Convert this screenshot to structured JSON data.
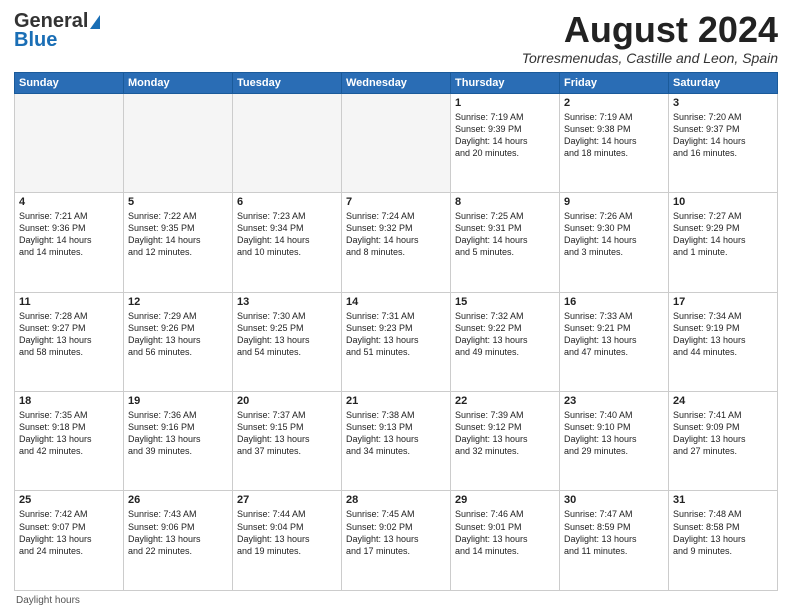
{
  "header": {
    "logo_general": "General",
    "logo_blue": "Blue",
    "title": "August 2024",
    "location": "Torresmenudas, Castille and Leon, Spain"
  },
  "footer": {
    "daylight_label": "Daylight hours"
  },
  "days_of_week": [
    "Sunday",
    "Monday",
    "Tuesday",
    "Wednesday",
    "Thursday",
    "Friday",
    "Saturday"
  ],
  "weeks": [
    [
      {
        "day": "",
        "info": ""
      },
      {
        "day": "",
        "info": ""
      },
      {
        "day": "",
        "info": ""
      },
      {
        "day": "",
        "info": ""
      },
      {
        "day": "1",
        "info": "Sunrise: 7:19 AM\nSunset: 9:39 PM\nDaylight: 14 hours\nand 20 minutes."
      },
      {
        "day": "2",
        "info": "Sunrise: 7:19 AM\nSunset: 9:38 PM\nDaylight: 14 hours\nand 18 minutes."
      },
      {
        "day": "3",
        "info": "Sunrise: 7:20 AM\nSunset: 9:37 PM\nDaylight: 14 hours\nand 16 minutes."
      }
    ],
    [
      {
        "day": "4",
        "info": "Sunrise: 7:21 AM\nSunset: 9:36 PM\nDaylight: 14 hours\nand 14 minutes."
      },
      {
        "day": "5",
        "info": "Sunrise: 7:22 AM\nSunset: 9:35 PM\nDaylight: 14 hours\nand 12 minutes."
      },
      {
        "day": "6",
        "info": "Sunrise: 7:23 AM\nSunset: 9:34 PM\nDaylight: 14 hours\nand 10 minutes."
      },
      {
        "day": "7",
        "info": "Sunrise: 7:24 AM\nSunset: 9:32 PM\nDaylight: 14 hours\nand 8 minutes."
      },
      {
        "day": "8",
        "info": "Sunrise: 7:25 AM\nSunset: 9:31 PM\nDaylight: 14 hours\nand 5 minutes."
      },
      {
        "day": "9",
        "info": "Sunrise: 7:26 AM\nSunset: 9:30 PM\nDaylight: 14 hours\nand 3 minutes."
      },
      {
        "day": "10",
        "info": "Sunrise: 7:27 AM\nSunset: 9:29 PM\nDaylight: 14 hours\nand 1 minute."
      }
    ],
    [
      {
        "day": "11",
        "info": "Sunrise: 7:28 AM\nSunset: 9:27 PM\nDaylight: 13 hours\nand 58 minutes."
      },
      {
        "day": "12",
        "info": "Sunrise: 7:29 AM\nSunset: 9:26 PM\nDaylight: 13 hours\nand 56 minutes."
      },
      {
        "day": "13",
        "info": "Sunrise: 7:30 AM\nSunset: 9:25 PM\nDaylight: 13 hours\nand 54 minutes."
      },
      {
        "day": "14",
        "info": "Sunrise: 7:31 AM\nSunset: 9:23 PM\nDaylight: 13 hours\nand 51 minutes."
      },
      {
        "day": "15",
        "info": "Sunrise: 7:32 AM\nSunset: 9:22 PM\nDaylight: 13 hours\nand 49 minutes."
      },
      {
        "day": "16",
        "info": "Sunrise: 7:33 AM\nSunset: 9:21 PM\nDaylight: 13 hours\nand 47 minutes."
      },
      {
        "day": "17",
        "info": "Sunrise: 7:34 AM\nSunset: 9:19 PM\nDaylight: 13 hours\nand 44 minutes."
      }
    ],
    [
      {
        "day": "18",
        "info": "Sunrise: 7:35 AM\nSunset: 9:18 PM\nDaylight: 13 hours\nand 42 minutes."
      },
      {
        "day": "19",
        "info": "Sunrise: 7:36 AM\nSunset: 9:16 PM\nDaylight: 13 hours\nand 39 minutes."
      },
      {
        "day": "20",
        "info": "Sunrise: 7:37 AM\nSunset: 9:15 PM\nDaylight: 13 hours\nand 37 minutes."
      },
      {
        "day": "21",
        "info": "Sunrise: 7:38 AM\nSunset: 9:13 PM\nDaylight: 13 hours\nand 34 minutes."
      },
      {
        "day": "22",
        "info": "Sunrise: 7:39 AM\nSunset: 9:12 PM\nDaylight: 13 hours\nand 32 minutes."
      },
      {
        "day": "23",
        "info": "Sunrise: 7:40 AM\nSunset: 9:10 PM\nDaylight: 13 hours\nand 29 minutes."
      },
      {
        "day": "24",
        "info": "Sunrise: 7:41 AM\nSunset: 9:09 PM\nDaylight: 13 hours\nand 27 minutes."
      }
    ],
    [
      {
        "day": "25",
        "info": "Sunrise: 7:42 AM\nSunset: 9:07 PM\nDaylight: 13 hours\nand 24 minutes."
      },
      {
        "day": "26",
        "info": "Sunrise: 7:43 AM\nSunset: 9:06 PM\nDaylight: 13 hours\nand 22 minutes."
      },
      {
        "day": "27",
        "info": "Sunrise: 7:44 AM\nSunset: 9:04 PM\nDaylight: 13 hours\nand 19 minutes."
      },
      {
        "day": "28",
        "info": "Sunrise: 7:45 AM\nSunset: 9:02 PM\nDaylight: 13 hours\nand 17 minutes."
      },
      {
        "day": "29",
        "info": "Sunrise: 7:46 AM\nSunset: 9:01 PM\nDaylight: 13 hours\nand 14 minutes."
      },
      {
        "day": "30",
        "info": "Sunrise: 7:47 AM\nSunset: 8:59 PM\nDaylight: 13 hours\nand 11 minutes."
      },
      {
        "day": "31",
        "info": "Sunrise: 7:48 AM\nSunset: 8:58 PM\nDaylight: 13 hours\nand 9 minutes."
      }
    ]
  ]
}
